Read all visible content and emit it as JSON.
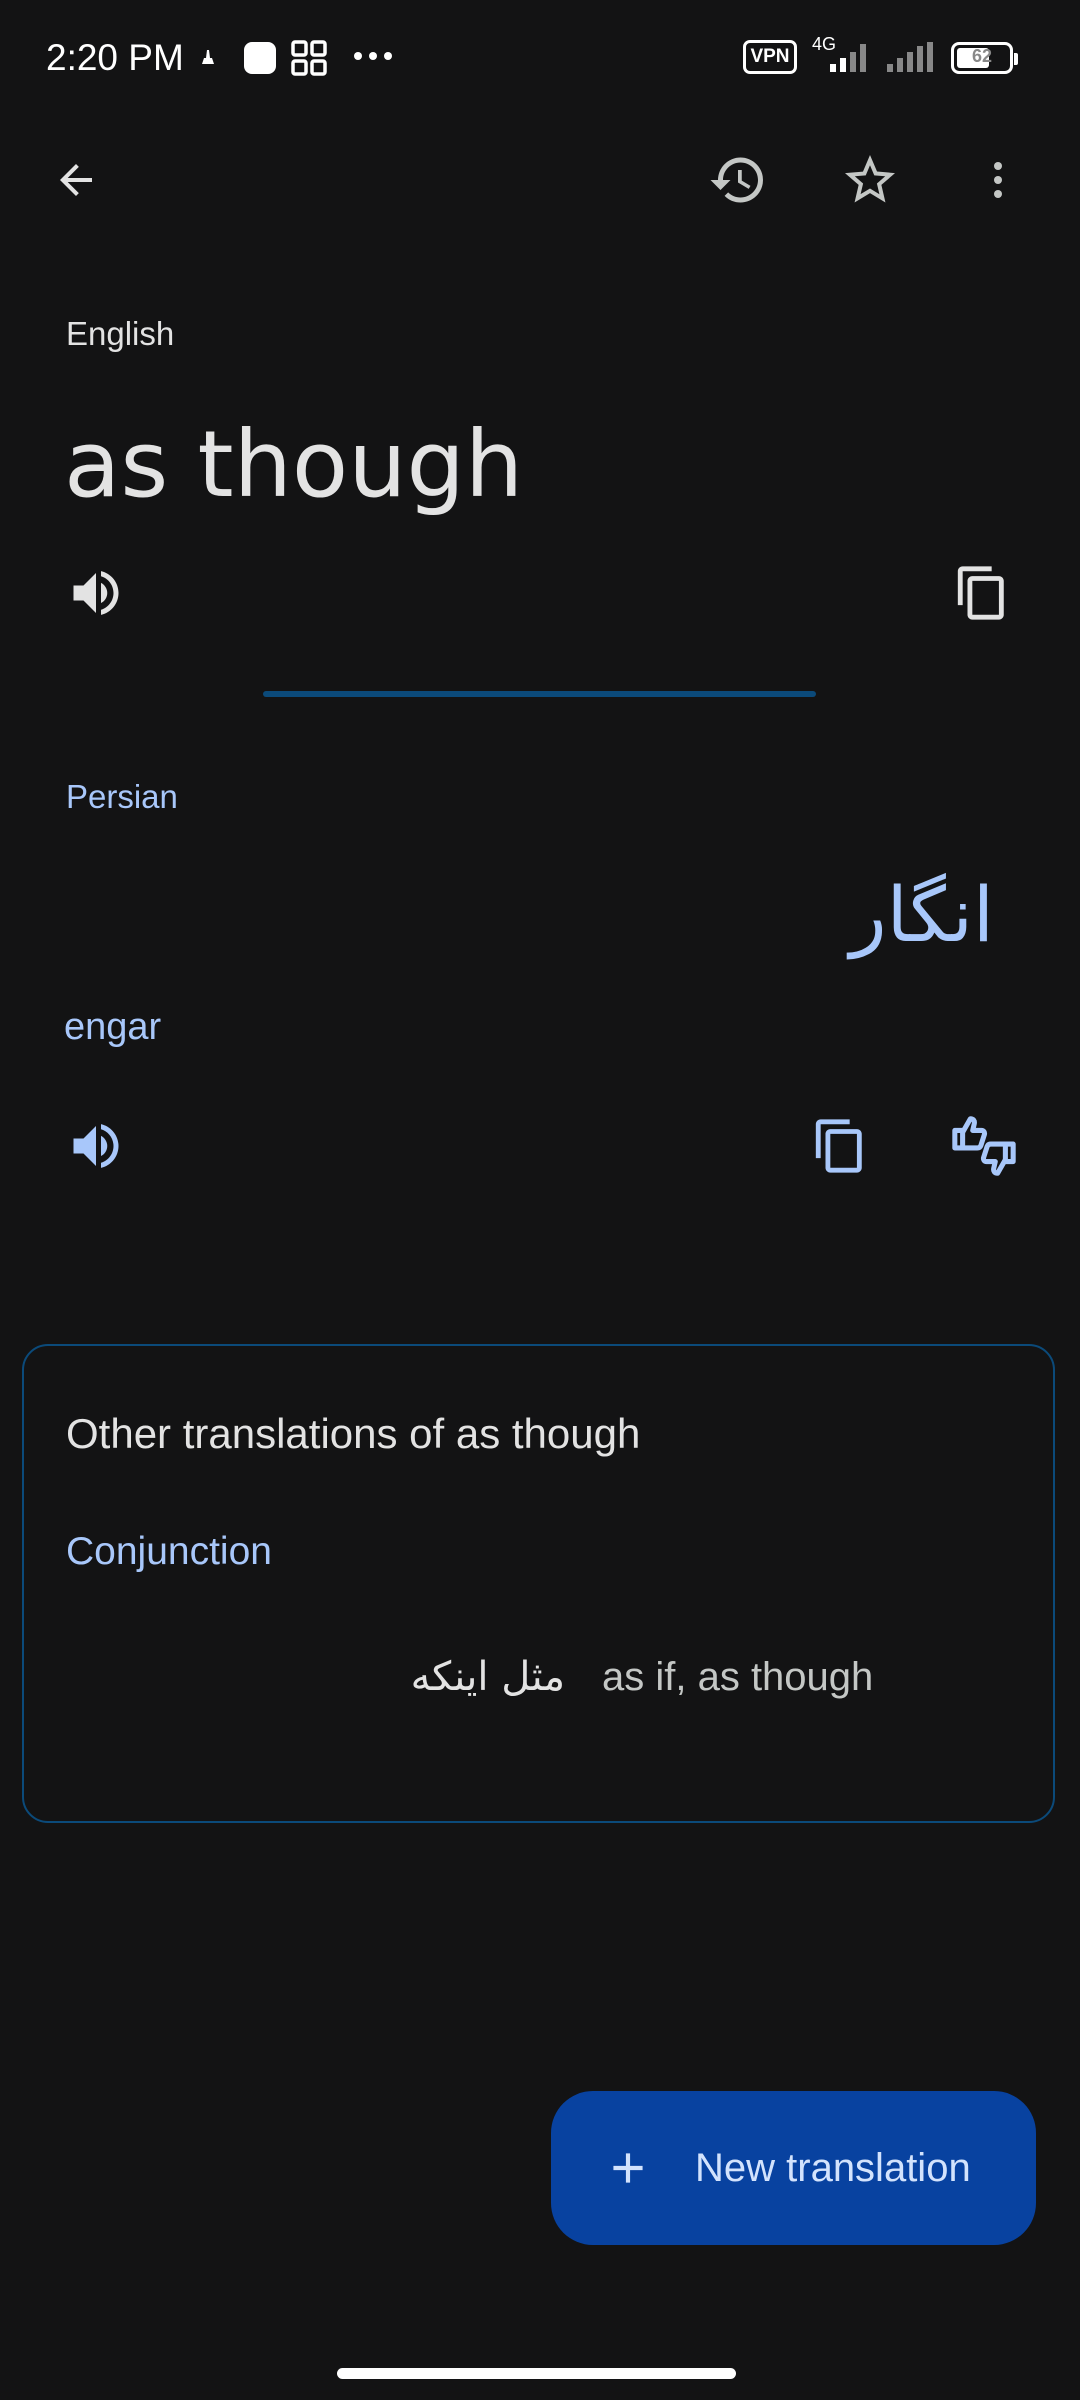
{
  "status_bar": {
    "time": "2:20 PM",
    "vpn": "VPN",
    "network": "4G",
    "battery": "62"
  },
  "source": {
    "language": "English",
    "text": "as though"
  },
  "target": {
    "language": "Persian",
    "text": "انگار",
    "transliteration": "engar"
  },
  "other_translations": {
    "title": "Other translations of as though",
    "entries": [
      {
        "part_of_speech": "Conjunction",
        "word": "مثل اینکه",
        "back_translations": "as if, as though"
      }
    ]
  },
  "fab": {
    "label": "New translation"
  },
  "colors": {
    "background": "#131314",
    "accent_text": "#a8c7fa",
    "fab": "#0842a0",
    "divider": "#0b4a7a"
  }
}
